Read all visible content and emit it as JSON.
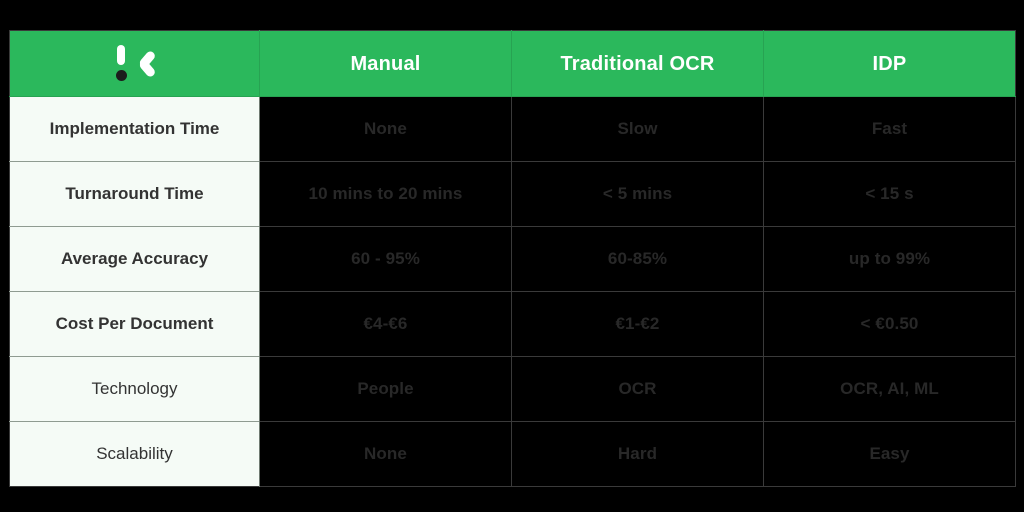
{
  "table": {
    "header": {
      "logo_label": "kobaro-logo",
      "columns": [
        "Manual",
        "Traditional OCR",
        "IDP"
      ]
    },
    "rows": [
      {
        "label": "Implementation Time",
        "label_weight": "bold",
        "values": [
          "None",
          "Slow",
          "Fast"
        ]
      },
      {
        "label": "Turnaround Time",
        "label_weight": "bold",
        "values": [
          "10 mins to 20 mins",
          "< 5 mins",
          "< 15 s"
        ]
      },
      {
        "label": "Average Accuracy",
        "label_weight": "bold",
        "values": [
          "60 - 95%",
          "60-85%",
          "up to 99%"
        ]
      },
      {
        "label": "Cost Per Document",
        "label_weight": "bold",
        "values": [
          "€4-€6",
          "€1-€2",
          "< €0.50"
        ]
      },
      {
        "label": "Technology",
        "label_weight": "normal",
        "values": [
          "People",
          "OCR",
          "OCR, AI, ML"
        ]
      },
      {
        "label": "Scalability",
        "label_weight": "normal",
        "values": [
          "None",
          "Hard",
          "Easy"
        ]
      }
    ]
  },
  "colors": {
    "header_green": "#2bb85c",
    "header_text": "#ffffff",
    "label_background": "#f5fbf6",
    "label_text": "#333333",
    "data_background": "#000000",
    "data_text": "#282828",
    "page_background": "#000000",
    "grid_line": "#3a3a3a"
  }
}
